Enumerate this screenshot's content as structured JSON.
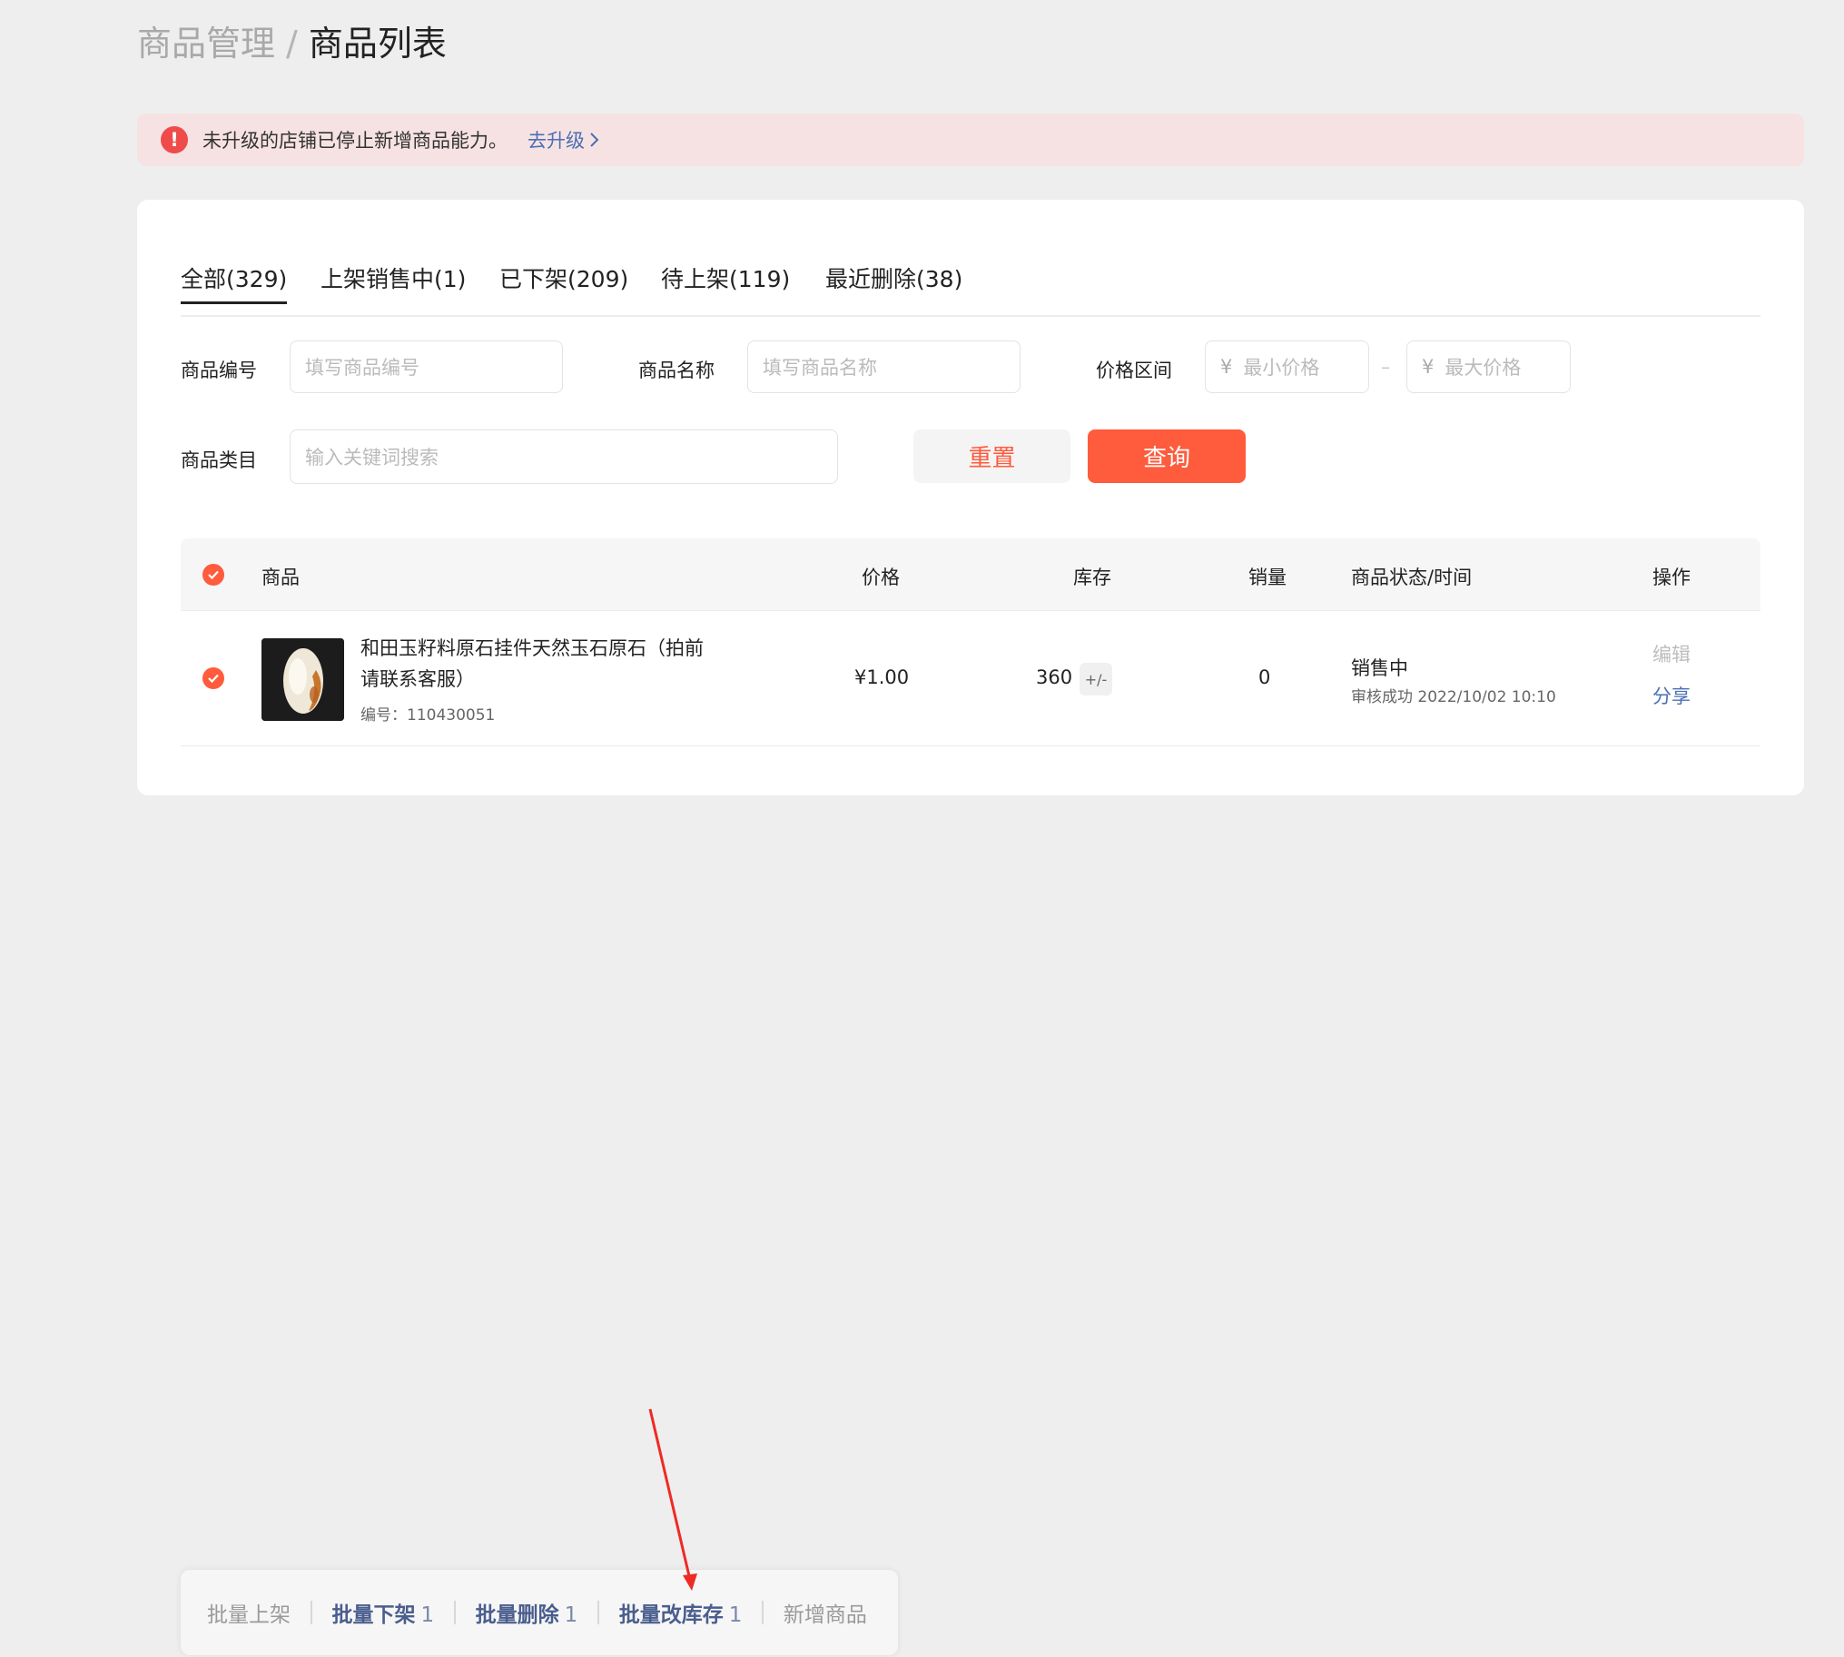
{
  "breadcrumb": {
    "parent": "商品管理",
    "separator": "/",
    "current": "商品列表"
  },
  "alert": {
    "icon": "exclamation-icon",
    "text": "未升级的店铺已停止新增商品能力。",
    "link": "去升级"
  },
  "tabs": [
    {
      "label": "全部(329)",
      "active": true
    },
    {
      "label": "上架销售中(1)"
    },
    {
      "label": "已下架(209)"
    },
    {
      "label": "待上架(119)"
    },
    {
      "label": "最近删除(38)"
    }
  ],
  "filters": {
    "code_label": "商品编号",
    "code_placeholder": "填写商品编号",
    "name_label": "商品名称",
    "name_placeholder": "填写商品名称",
    "price_label": "价格区间",
    "currency": "¥",
    "min_placeholder": "最小价格",
    "max_placeholder": "最大价格",
    "range_dash": "–",
    "category_label": "商品类目",
    "category_placeholder": "输入关键词搜索",
    "reset_label": "重置",
    "query_label": "查询"
  },
  "table": {
    "headers": {
      "product": "商品",
      "price": "价格",
      "stock": "库存",
      "sales": "销量",
      "status": "商品状态/时间",
      "ops": "操作"
    },
    "rows": [
      {
        "name": "和田玉籽料原石挂件天然玉石原石（拍前请联系客服）",
        "code": "编号：110430051",
        "price": "¥1.00",
        "stock": "360",
        "stock_edit": "+/-",
        "sales": "0",
        "status": "销售中",
        "status_detail": "审核成功 2022/10/02 10:10",
        "edit": "编辑",
        "share": "分享"
      }
    ]
  },
  "bottom_bar": {
    "batch_list": "批量上架",
    "batch_unlist": "批量下架",
    "batch_unlist_count": "1",
    "batch_delete": "批量删除",
    "batch_delete_count": "1",
    "batch_stock": "批量改库存",
    "batch_stock_count": "1",
    "add_product": "新增商品"
  },
  "colors": {
    "accent": "#ff5b3d",
    "link": "#4a6fb4",
    "alert_bg": "#f7e2e3",
    "page_bg": "#eeeeee"
  }
}
